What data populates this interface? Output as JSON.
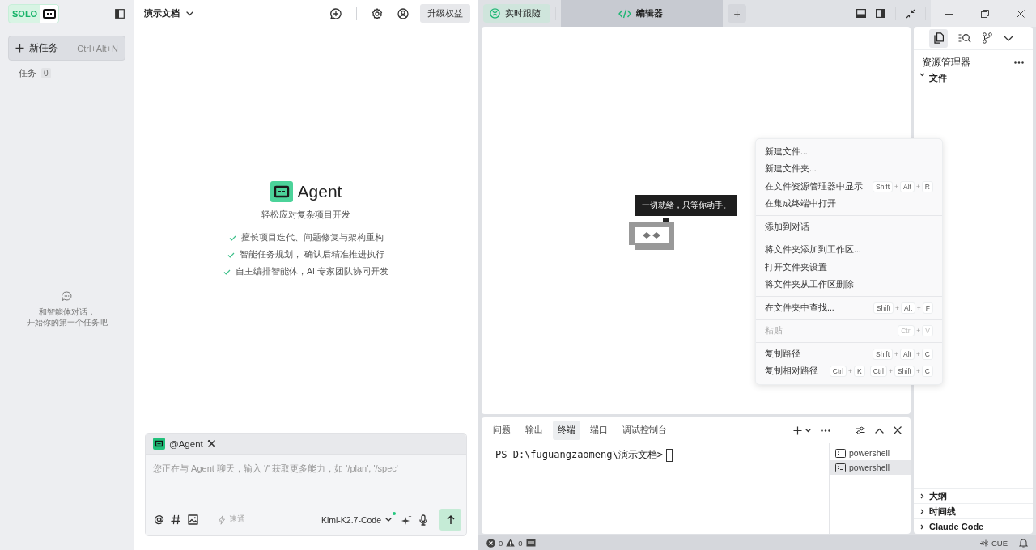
{
  "sidebar": {
    "logo": "SOLO",
    "new_task": {
      "label": "新任务",
      "shortcut": "Ctrl+Alt+N"
    },
    "tasks": {
      "label": "任务",
      "count": "0"
    },
    "empty_hint": [
      "和智能体对话，",
      "开始你的第一个任务吧"
    ]
  },
  "chat": {
    "project": "演示文档",
    "upgrade": "升级权益",
    "agent": {
      "title": "Agent",
      "subtitle": "轻松应对复杂项目开发",
      "features": [
        "擅长项目迭代、问题修复与架构重构",
        "智能任务规划， 确认后精准推进执行",
        "自主编排智能体，AI 专家团队协同开发"
      ]
    },
    "composer": {
      "mention": "@Agent",
      "placeholder": "您正在与 Agent 聊天，输入 '/' 获取更多能力，如 '/plan', '/spec'",
      "speed": {
        "label": "速通",
        "on": false
      },
      "model": "Kimi-K2.7-Code",
      "model_online": true
    }
  },
  "workspace": {
    "tabs": [
      {
        "label": "实时跟随",
        "kind": "follow",
        "selected": false
      },
      {
        "label": "编辑器",
        "kind": "editor",
        "selected": true
      }
    ],
    "add_tab": "+",
    "editor": {
      "tooltip": "一切就绪，只等你动手。"
    },
    "context_menu": {
      "key_joiner": "+",
      "groups": [
        [
          {
            "label": "新建文件...",
            "disabled": false
          },
          {
            "label": "新建文件夹...",
            "disabled": false
          },
          {
            "label": "在文件资源管理器中显示",
            "disabled": false,
            "shortcut": [
              [
                "Shift",
                "Alt",
                "R"
              ]
            ]
          },
          {
            "label": "在集成终端中打开",
            "disabled": false
          }
        ],
        [
          {
            "label": "添加到对话",
            "disabled": false
          }
        ],
        [
          {
            "label": "将文件夹添加到工作区...",
            "disabled": false
          },
          {
            "label": "打开文件夹设置",
            "disabled": false
          },
          {
            "label": "将文件夹从工作区删除",
            "disabled": false
          }
        ],
        [
          {
            "label": "在文件夹中查找...",
            "disabled": false,
            "shortcut": [
              [
                "Shift",
                "Alt",
                "F"
              ]
            ]
          }
        ],
        [
          {
            "label": "粘贴",
            "disabled": true,
            "shortcut": [
              [
                "Ctrl",
                "V"
              ]
            ]
          }
        ],
        [
          {
            "label": "复制路径",
            "disabled": false,
            "shortcut": [
              [
                "Shift",
                "Alt",
                "C"
              ]
            ]
          },
          {
            "label": "复制相对路径",
            "disabled": false,
            "shortcut": [
              [
                "Ctrl",
                "K"
              ],
              [
                "Ctrl",
                "Shift",
                "C"
              ]
            ]
          }
        ]
      ]
    },
    "panel": {
      "tabs": [
        {
          "label": "问题",
          "selected": false
        },
        {
          "label": "输出",
          "selected": false
        },
        {
          "label": "终端",
          "selected": true
        },
        {
          "label": "端口",
          "selected": false
        },
        {
          "label": "调试控制台",
          "selected": false
        }
      ],
      "prompt": "PS D:\\fuguangzaomeng\\演示文档>",
      "terminals": [
        {
          "label": "powershell",
          "selected": false
        },
        {
          "label": "powershell",
          "selected": true
        }
      ]
    },
    "explorer": {
      "title": "资源管理器",
      "sections": [
        {
          "label": "文件",
          "expanded": true
        },
        {
          "label": "大纲",
          "expanded": false
        },
        {
          "label": "时间线",
          "expanded": false
        },
        {
          "label": "Claude Code",
          "expanded": false
        }
      ]
    },
    "status_bar": {
      "errors": "0",
      "warnings": "0",
      "language": "CUE"
    }
  }
}
